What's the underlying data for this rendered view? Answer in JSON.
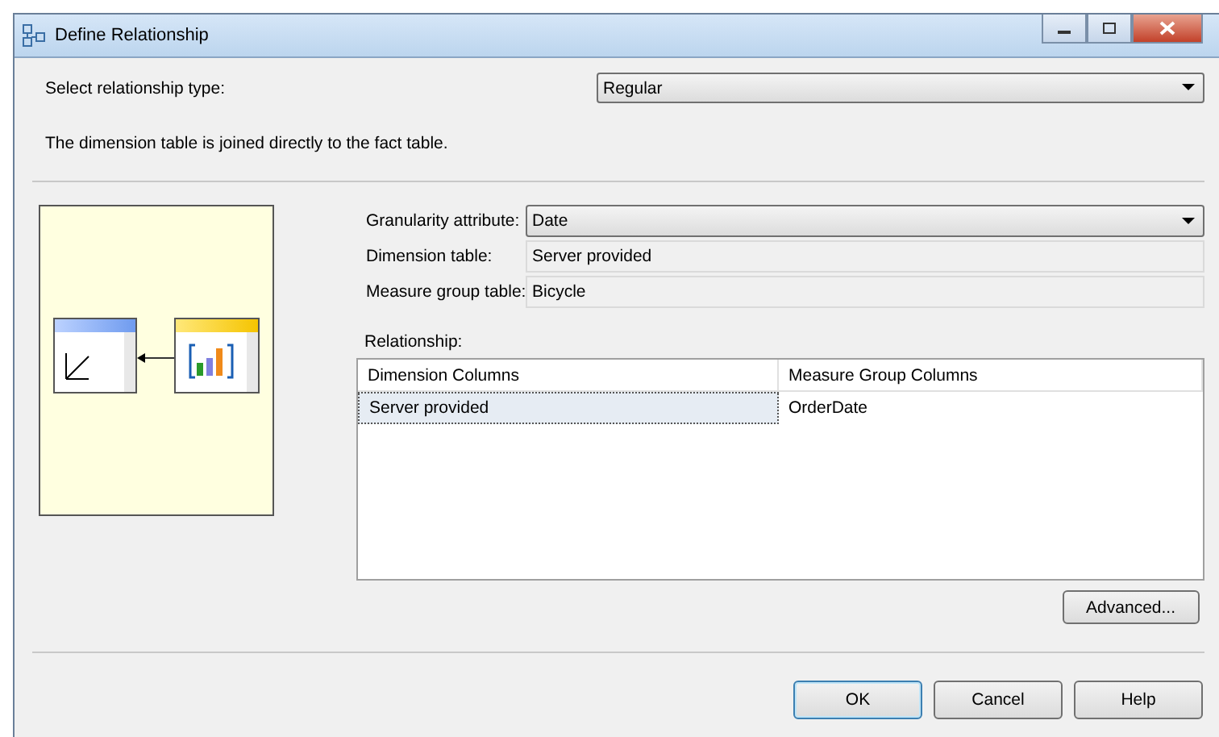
{
  "window": {
    "title": "Define Relationship"
  },
  "relationship_type": {
    "label": "Select relationship type:",
    "value": "Regular"
  },
  "description": "The dimension table is joined directly to the fact table.",
  "fields": [
    {
      "kind": "dropdown",
      "label": "Granularity attribute:",
      "value": "Date"
    },
    {
      "kind": "readonly",
      "label": "Dimension table:",
      "value": "Server provided"
    },
    {
      "kind": "readonly",
      "label": "Measure group table:",
      "value": "Bicycle"
    }
  ],
  "relationship": {
    "label": "Relationship:",
    "columns": [
      "Dimension Columns",
      "Measure Group Columns"
    ],
    "rows": [
      {
        "cells": [
          "Server provided",
          "OrderDate"
        ],
        "selected": true
      }
    ]
  },
  "advanced_button": "Advanced...",
  "buttons": [
    {
      "label": "OK",
      "default": true
    },
    {
      "label": "Cancel",
      "default": false
    },
    {
      "label": "Help",
      "default": false
    }
  ]
}
